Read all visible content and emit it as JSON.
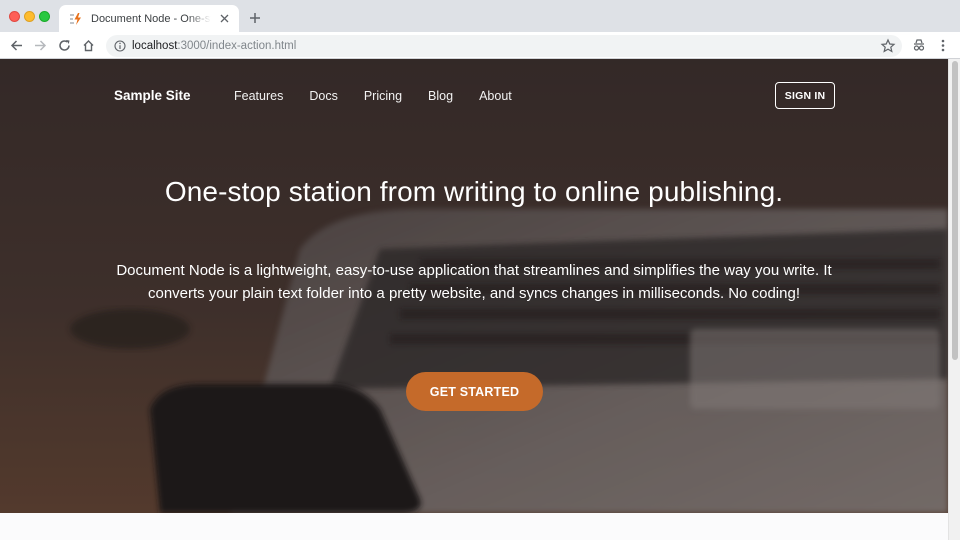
{
  "browser": {
    "tab_title": "Document Node - One-stop station from writing to online publishing",
    "url_host": "localhost",
    "url_path": ":3000/index-action.html"
  },
  "site": {
    "brand": "Sample Site",
    "nav": [
      "Features",
      "Docs",
      "Pricing",
      "Blog",
      "About"
    ],
    "signin_label": "SIGN IN"
  },
  "hero": {
    "headline": "One-stop station from writing to online publishing.",
    "lead": "Document Node is a lightweight, easy-to-use application that streamlines and simplifies the way you write. It converts your plain text folder into a pretty website, and syncs changes in milliseconds. No coding!",
    "cta_label": "GET STARTED"
  },
  "colors": {
    "accent": "#c56a2a",
    "hero_overlay": "#3e3432"
  },
  "icons": {
    "tab_favicon": "lightning-icon",
    "back": "arrow-left-icon",
    "forward": "arrow-right-icon",
    "reload": "reload-icon",
    "home": "home-icon",
    "info": "info-icon",
    "bookmark": "star-icon",
    "extension": "incognito-icon",
    "menu": "kebab-menu-icon"
  }
}
